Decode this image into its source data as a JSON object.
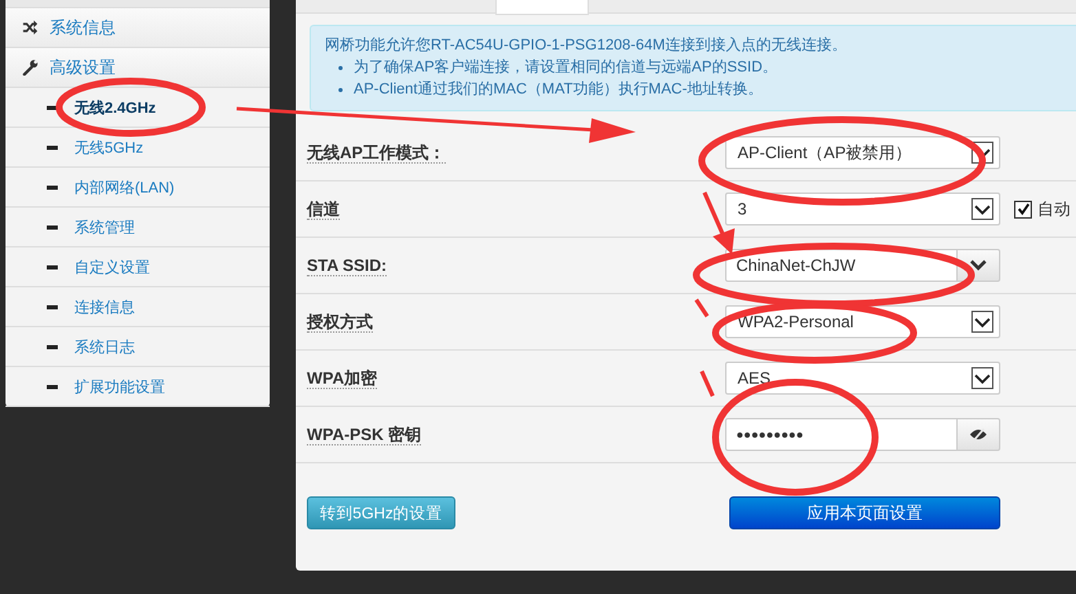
{
  "sidebar": {
    "sections": [
      {
        "label": "系统信息"
      },
      {
        "label": "高级设置"
      }
    ],
    "items": [
      {
        "label": "无线2.4GHz",
        "selected": true
      },
      {
        "label": "无线5GHz",
        "selected": false
      },
      {
        "label": "内部网络(LAN)",
        "selected": false
      },
      {
        "label": "系统管理",
        "selected": false
      },
      {
        "label": "自定义设置",
        "selected": false
      },
      {
        "label": "连接信息",
        "selected": false
      },
      {
        "label": "系统日志",
        "selected": false
      },
      {
        "label": "扩展功能设置",
        "selected": false
      }
    ]
  },
  "info": {
    "intro": "网桥功能允许您RT-AC54U-GPIO-1-PSG1208-64M连接到接入点的无线连接。",
    "bullets": [
      "为了确保AP客户端连接，请设置相同的信道与远端AP的SSID。",
      "AP-Client通过我们的MAC（MAT功能）执行MAC-地址转换。"
    ]
  },
  "form": [
    {
      "kind": "select",
      "label": "无线AP工作模式：",
      "value": "AP-Client（AP被禁用）"
    },
    {
      "kind": "select",
      "label": "信道",
      "value": "3",
      "checkbox": {
        "label": "自动",
        "checked": true
      }
    },
    {
      "kind": "combo",
      "label": "STA SSID:",
      "value": "ChinaNet-ChJW"
    },
    {
      "kind": "select",
      "label": "授权方式",
      "value": "WPA2-Personal"
    },
    {
      "kind": "select",
      "label": "WPA加密",
      "value": "AES"
    },
    {
      "kind": "password",
      "label": "WPA-PSK 密钥",
      "value": "●●●●●●●●●"
    }
  ],
  "buttons": [
    {
      "label": "转到5GHz的设置",
      "kind": "secondary"
    },
    {
      "label": "应用本页面设置",
      "kind": "primary"
    }
  ]
}
